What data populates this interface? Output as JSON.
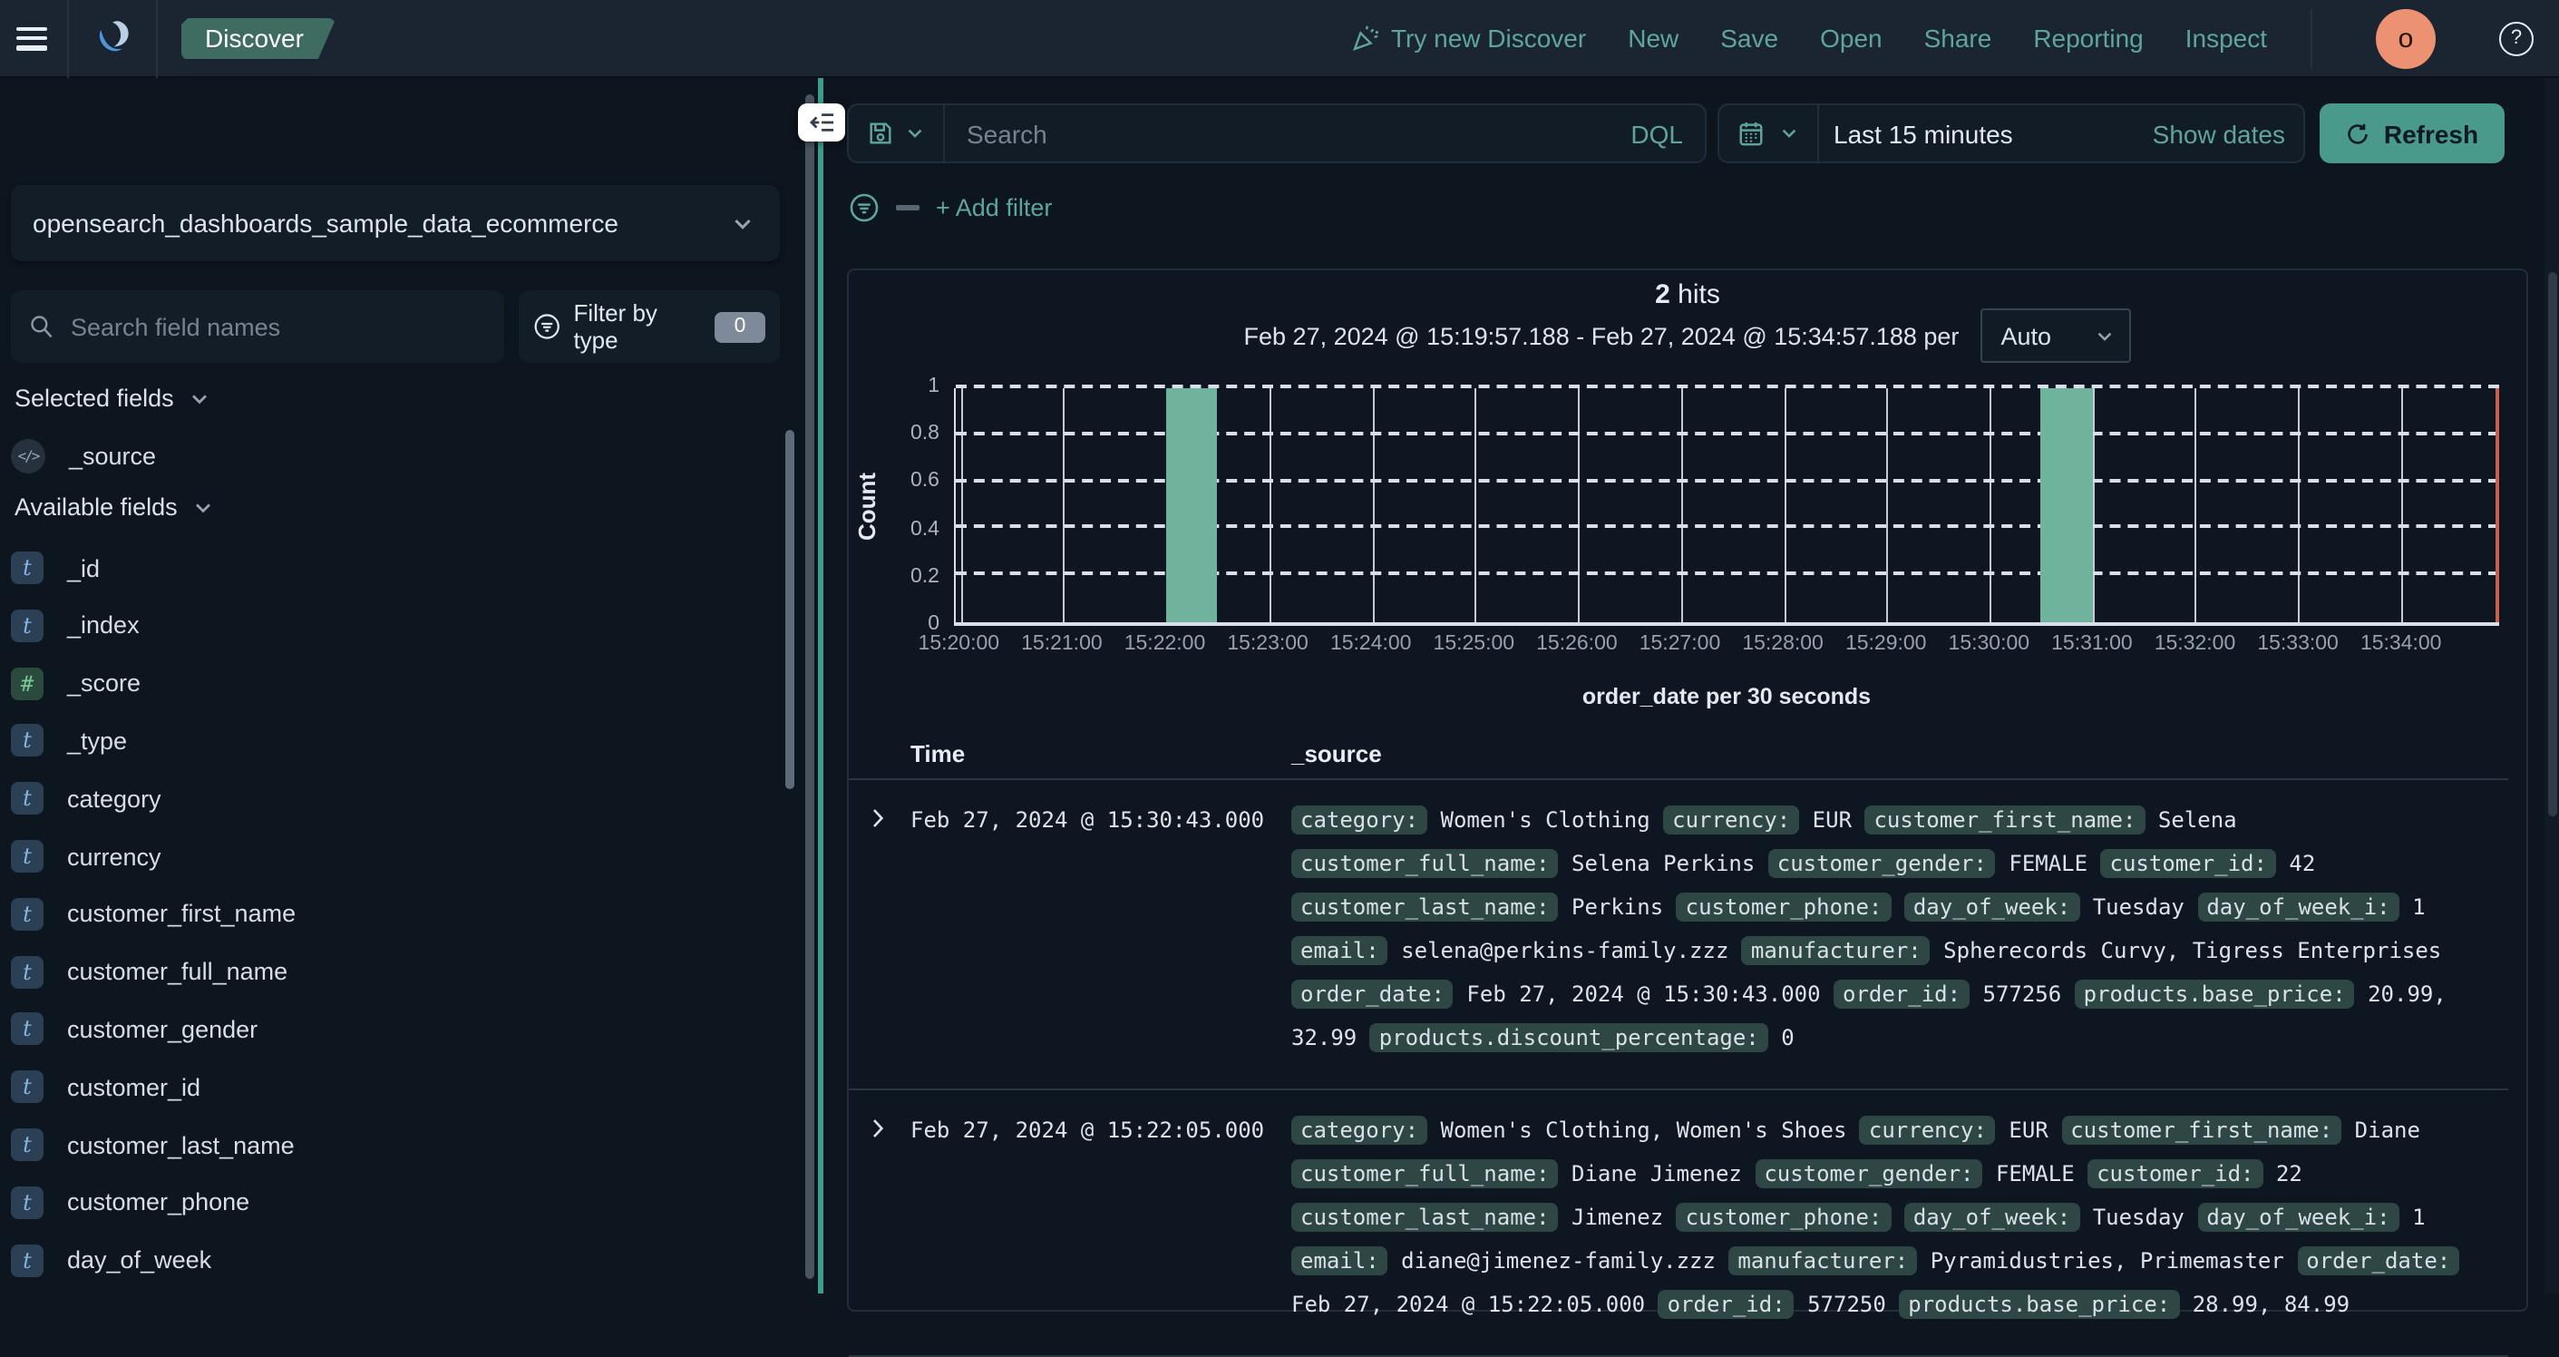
{
  "header": {
    "app_badge": "Discover",
    "nav_links": [
      "Try new Discover",
      "New",
      "Save",
      "Open",
      "Share",
      "Reporting",
      "Inspect"
    ],
    "avatar_letter": "o",
    "help_glyph": "?"
  },
  "query_bar": {
    "search_placeholder": "Search",
    "language_button": "DQL",
    "time_value": "Last 15 minutes",
    "show_dates_label": "Show dates",
    "refresh_label": "Refresh"
  },
  "filter_bar": {
    "add_filter_label": "+ Add filter"
  },
  "sidebar": {
    "index_pattern": "opensearch_dashboards_sample_data_ecommerce",
    "search_placeholder": "Search field names",
    "filter_by_type_label": "Filter by type",
    "filter_count": "0",
    "selected_heading": "Selected fields",
    "selected_fields": [
      {
        "name": "_source",
        "type": "source"
      }
    ],
    "available_heading": "Available fields",
    "available_fields": [
      {
        "name": "_id",
        "type": "t"
      },
      {
        "name": "_index",
        "type": "t"
      },
      {
        "name": "_score",
        "type": "#"
      },
      {
        "name": "_type",
        "type": "t"
      },
      {
        "name": "category",
        "type": "t"
      },
      {
        "name": "currency",
        "type": "t"
      },
      {
        "name": "customer_first_name",
        "type": "t"
      },
      {
        "name": "customer_full_name",
        "type": "t"
      },
      {
        "name": "customer_gender",
        "type": "t"
      },
      {
        "name": "customer_id",
        "type": "t"
      },
      {
        "name": "customer_last_name",
        "type": "t"
      },
      {
        "name": "customer_phone",
        "type": "t"
      },
      {
        "name": "day_of_week",
        "type": "t"
      }
    ]
  },
  "results": {
    "hits_count": "2",
    "hits_label": "hits",
    "range_text": "Feb 27, 2024 @ 15:19:57.188 - Feb 27, 2024 @ 15:34:57.188 per",
    "interval_selected": "Auto",
    "table": {
      "time_header": "Time",
      "source_header": "_source",
      "rows": [
        {
          "time": "Feb 27, 2024 @ 15:30:43.000",
          "fields": [
            [
              "category",
              "Women's Clothing"
            ],
            [
              "currency",
              "EUR"
            ],
            [
              "customer_first_name",
              "Selena"
            ],
            [
              "customer_full_name",
              "Selena Perkins"
            ],
            [
              "customer_gender",
              "FEMALE"
            ],
            [
              "customer_id",
              "42"
            ],
            [
              "customer_last_name",
              "Perkins"
            ],
            [
              "customer_phone",
              ""
            ],
            [
              "day_of_week",
              "Tuesday"
            ],
            [
              "day_of_week_i",
              "1"
            ],
            [
              "email",
              "selena@perkins-family.zzz"
            ],
            [
              "manufacturer",
              "Spherecords Curvy, Tigress Enterprises"
            ],
            [
              "order_date",
              "Feb 27, 2024 @ 15:30:43.000"
            ],
            [
              "order_id",
              "577256"
            ],
            [
              "products.base_price",
              "20.99, 32.99"
            ],
            [
              "products.discount_percentage",
              "0"
            ]
          ]
        },
        {
          "time": "Feb 27, 2024 @ 15:22:05.000",
          "fields": [
            [
              "category",
              "Women's Clothing, Women's Shoes"
            ],
            [
              "currency",
              "EUR"
            ],
            [
              "customer_first_name",
              "Diane"
            ],
            [
              "customer_full_name",
              "Diane Jimenez"
            ],
            [
              "customer_gender",
              "FEMALE"
            ],
            [
              "customer_id",
              "22"
            ],
            [
              "customer_last_name",
              "Jimenez"
            ],
            [
              "customer_phone",
              ""
            ],
            [
              "day_of_week",
              "Tuesday"
            ],
            [
              "day_of_week_i",
              "1"
            ],
            [
              "email",
              "diane@jimenez-family.zzz"
            ],
            [
              "manufacturer",
              "Pyramidustries, Primemaster"
            ],
            [
              "order_date",
              "Feb 27, 2024 @ 15:22:05.000"
            ],
            [
              "order_id",
              "577250"
            ],
            [
              "products.base_price",
              "28.99, 84.99"
            ]
          ]
        }
      ]
    }
  },
  "chart_data": {
    "type": "bar",
    "title": "order_date per 30 seconds",
    "ylabel": "Count",
    "xlabel": "order_date per 30 seconds",
    "ylim": [
      0,
      1
    ],
    "yticks": [
      0,
      0.2,
      0.4,
      0.6,
      0.8,
      1
    ],
    "x_start": "15:19:57.188",
    "x_end": "15:34:57.188",
    "x_ticks": [
      "15:20:00",
      "15:21:00",
      "15:22:00",
      "15:23:00",
      "15:24:00",
      "15:25:00",
      "15:26:00",
      "15:27:00",
      "15:28:00",
      "15:29:00",
      "15:30:00",
      "15:31:00",
      "15:32:00",
      "15:33:00",
      "15:34:00"
    ],
    "bars": [
      {
        "from": "15:22:00",
        "to": "15:22:30",
        "count": 1
      },
      {
        "from": "15:30:30",
        "to": "15:31:00",
        "count": 1
      }
    ],
    "bar_color": "#6fb39d",
    "now_line_color": "#c4604d",
    "grid": true,
    "legend": false
  },
  "colors": {
    "accent_teal": "#5ea69c",
    "button_teal": "#4a9a8b",
    "bar_green": "#6fb39d",
    "field_badge_bg": "#2e4644",
    "now_line": "#c4604d",
    "avatar": "#ec9171",
    "discover_badge": "#3e6c60"
  }
}
